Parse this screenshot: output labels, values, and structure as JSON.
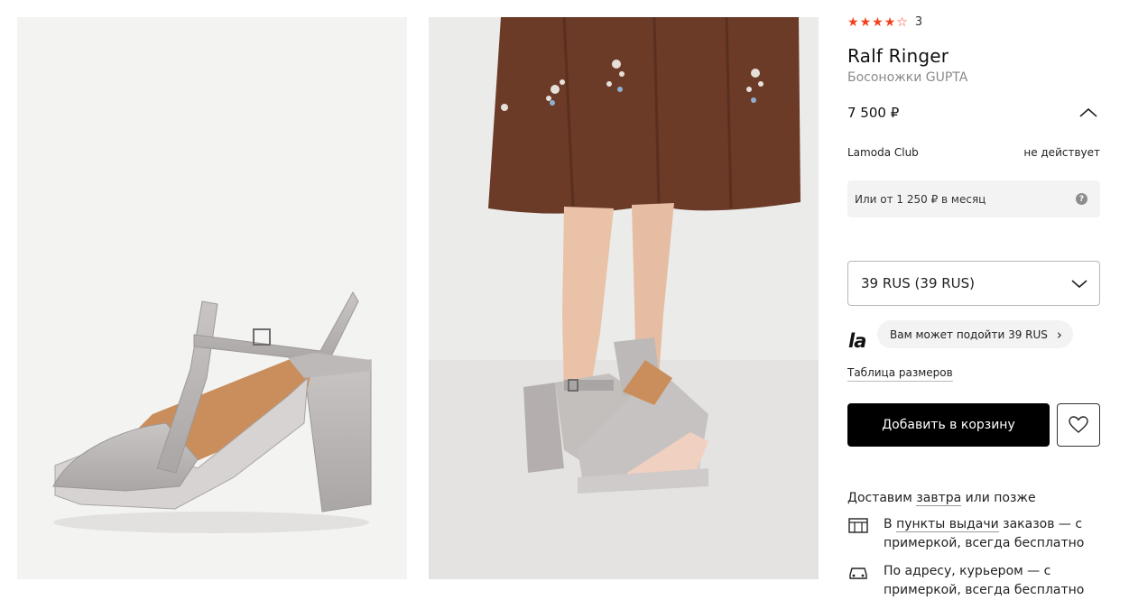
{
  "product": {
    "rating_value": 4.5,
    "rating_count": "3",
    "brand": "Ralf Ringer",
    "name": "Босоножки GUPTA",
    "price": "7 500 ₽"
  },
  "club": {
    "label": "Lamoda Club",
    "status": "не действует"
  },
  "installment": {
    "text": "Или от 1 250 ₽ в месяц"
  },
  "size": {
    "selected": "39 RUS (39 RUS)",
    "logo": "la",
    "hint": "Вам может подойти 39 RUS",
    "table_link": "Таблица размеров"
  },
  "actions": {
    "add_to_cart": "Добавить в корзину"
  },
  "delivery": {
    "prefix": "Доставим",
    "when": "завтра",
    "suffix": "или позже",
    "options": [
      {
        "pre": "В",
        "link": "пункты выдачи",
        "rest": "заказов — с примеркой, всегда бесплатно"
      },
      {
        "pre": "",
        "link": "",
        "rest": "По адресу, курьером — с примеркой, всегда бесплатно"
      }
    ]
  },
  "colors": {
    "accent_star": "#f43f1b",
    "button": "#000000",
    "muted": "#8a8a8a"
  }
}
